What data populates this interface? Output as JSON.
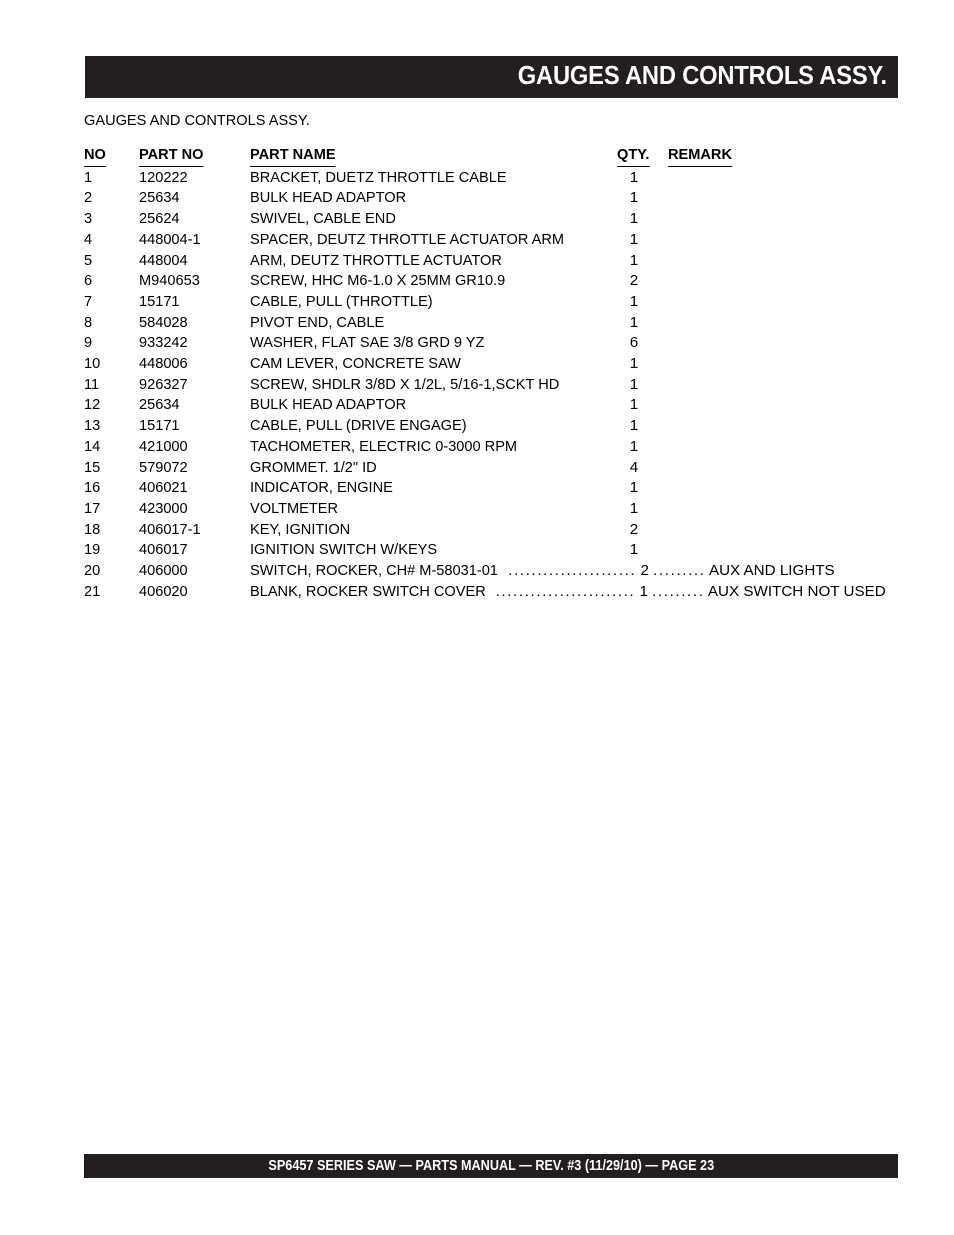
{
  "header": {
    "title": "GAUGES AND CONTROLS ASSY."
  },
  "subtitle": "GAUGES AND CONTROLS ASSY.",
  "table": {
    "columns": {
      "no": "NO",
      "part_no": "PART NO",
      "part_name": "PART NAME",
      "qty": "QTY.",
      "remark": "REMARK"
    },
    "rows": [
      {
        "no": "1",
        "part_no": "120222",
        "part_name": "BRACKET, DUETZ THROTTLE CABLE",
        "qty": "1",
        "remark": ""
      },
      {
        "no": "2",
        "part_no": "25634",
        "part_name": "BULK HEAD ADAPTOR",
        "qty": "1",
        "remark": ""
      },
      {
        "no": "3",
        "part_no": "25624",
        "part_name": "SWIVEL, CABLE END",
        "qty": "1",
        "remark": ""
      },
      {
        "no": "4",
        "part_no": "448004-1",
        "part_name": "SPACER, DEUTZ THROTTLE ACTUATOR ARM",
        "qty": "1",
        "remark": ""
      },
      {
        "no": "5",
        "part_no": "448004",
        "part_name": "ARM, DEUTZ THROTTLE ACTUATOR",
        "qty": "1",
        "remark": ""
      },
      {
        "no": "6",
        "part_no": "M940653",
        "part_name": "SCREW, HHC M6-1.0 X 25MM GR10.9",
        "qty": "2",
        "remark": ""
      },
      {
        "no": "7",
        "part_no": "15171",
        "part_name": "CABLE, PULL (THROTTLE)",
        "qty": "1",
        "remark": ""
      },
      {
        "no": "8",
        "part_no": "584028",
        "part_name": "PIVOT END, CABLE",
        "qty": "1",
        "remark": ""
      },
      {
        "no": "9",
        "part_no": "933242",
        "part_name": "WASHER, FLAT SAE 3/8 GRD 9 YZ",
        "qty": "6",
        "remark": ""
      },
      {
        "no": "10",
        "part_no": "448006",
        "part_name": "CAM LEVER, CONCRETE SAW",
        "qty": "1",
        "remark": ""
      },
      {
        "no": "11",
        "part_no": "926327",
        "part_name": "SCREW, SHDLR 3/8D X 1/2L, 5/16-1,SCKT HD",
        "qty": "1",
        "remark": ""
      },
      {
        "no": "12",
        "part_no": "25634",
        "part_name": "BULK HEAD ADAPTOR",
        "qty": "1",
        "remark": ""
      },
      {
        "no": "13",
        "part_no": "15171",
        "part_name": "CABLE, PULL (DRIVE ENGAGE)",
        "qty": "1",
        "remark": ""
      },
      {
        "no": "14",
        "part_no": "421000",
        "part_name": "TACHOMETER, ELECTRIC 0-3000 RPM",
        "qty": "1",
        "remark": ""
      },
      {
        "no": "15",
        "part_no": "579072",
        "part_name": "GROMMET. 1/2\" ID",
        "qty": "4",
        "remark": ""
      },
      {
        "no": "16",
        "part_no": "406021",
        "part_name": "INDICATOR, ENGINE",
        "qty": "1",
        "remark": ""
      },
      {
        "no": "17",
        "part_no": "423000",
        "part_name": "VOLTMETER",
        "qty": "1",
        "remark": ""
      },
      {
        "no": "18",
        "part_no": "406017-1",
        "part_name": "KEY, IGNITION",
        "qty": "2",
        "remark": ""
      },
      {
        "no": "19",
        "part_no": "406017",
        "part_name": "IGNITION SWITCH W/KEYS",
        "qty": "1",
        "remark": ""
      },
      {
        "no": "20",
        "part_no": "406000",
        "part_name": "SWITCH, ROCKER, CH# M-58031-01",
        "qty": "2",
        "remark": "AUX AND LIGHTS",
        "leader": true,
        "dots1": "......................",
        "dots2": "........."
      },
      {
        "no": "21",
        "part_no": "406020",
        "part_name": "BLANK, ROCKER SWITCH COVER",
        "qty": "1",
        "remark": "AUX SWITCH NOT USED",
        "leader": true,
        "dots1": "........................",
        "dots2": "........."
      }
    ]
  },
  "footer": {
    "text": "SP6457 SERIES SAW —  PARTS MANUAL — REV. #3  (11/29/10) — PAGE 23"
  },
  "colors": {
    "bar": "#231f20",
    "bar_text": "#ffffff",
    "page_text": "#000000",
    "page_bg": "#ffffff"
  }
}
